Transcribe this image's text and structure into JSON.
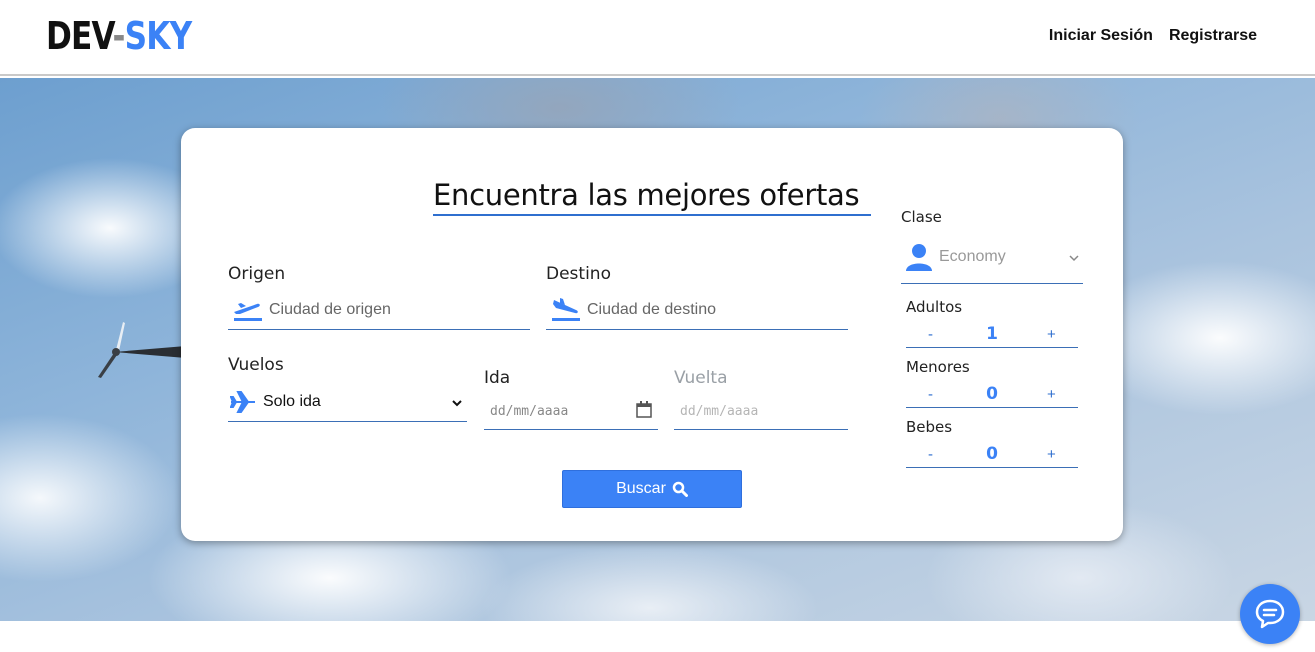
{
  "header": {
    "logo_part1": "DEV",
    "logo_dash": "-",
    "logo_part2": "SKY",
    "nav": {
      "login": "Iniciar Sesión",
      "register": "Registrarse"
    }
  },
  "search": {
    "title": "Encuentra las mejores ofertas",
    "origin": {
      "label": "Origen",
      "placeholder": "Ciudad de origen",
      "icon": "plane-departure-icon"
    },
    "destination": {
      "label": "Destino",
      "placeholder": "Ciudad de destino",
      "icon": "plane-arrival-icon"
    },
    "flights": {
      "label": "Vuelos",
      "value": "Solo ida",
      "icon": "plane-icon"
    },
    "departure": {
      "label": "Ida",
      "placeholder": "dd/mm/aaaa"
    },
    "return": {
      "label": "Vuelta",
      "placeholder": "dd/mm/aaaa"
    },
    "search_button": "Buscar"
  },
  "passengers": {
    "class": {
      "label": "Clase",
      "value": "Economy",
      "icon": "user-icon"
    },
    "adults": {
      "label": "Adultos",
      "value": "1",
      "minus": "-",
      "plus": "+"
    },
    "minors": {
      "label": "Menores",
      "value": "0",
      "minus": "-",
      "plus": "+"
    },
    "babies": {
      "label": "Bebes",
      "value": "0",
      "minus": "-",
      "plus": "+"
    }
  },
  "colors": {
    "accent": "#3b82f6",
    "underline": "#2f6fcf"
  }
}
